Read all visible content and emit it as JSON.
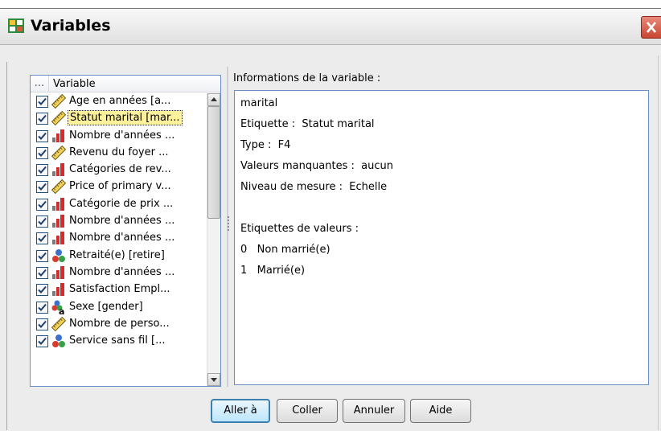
{
  "window": {
    "title": "Variables"
  },
  "list": {
    "header_col1": "...",
    "header_col2": "Variable",
    "items": [
      {
        "label": "Age en années [a...",
        "icon": "scale-ruler-icon",
        "checked": true
      },
      {
        "label": "Statut marital [mar...",
        "icon": "scale-ruler-icon",
        "checked": true,
        "selected": true
      },
      {
        "label": "Nombre d'années ...",
        "icon": "ordinal-bar-icon",
        "checked": true
      },
      {
        "label": "Revenu du foyer ...",
        "icon": "scale-ruler-icon",
        "checked": true
      },
      {
        "label": "Catégories de rev...",
        "icon": "ordinal-bar-icon",
        "checked": true
      },
      {
        "label": "Price of primary v...",
        "icon": "scale-ruler-icon",
        "checked": true
      },
      {
        "label": "Catégorie de prix ...",
        "icon": "ordinal-bar-icon",
        "checked": true
      },
      {
        "label": "Nombre d'années ...",
        "icon": "ordinal-bar-icon",
        "checked": true
      },
      {
        "label": "Nombre d'années ...",
        "icon": "ordinal-bar-icon",
        "checked": true
      },
      {
        "label": "Retraité(e) [retire]",
        "icon": "nominal-circles-icon",
        "checked": true
      },
      {
        "label": "Nombre d'années ...",
        "icon": "ordinal-bar-icon",
        "checked": true
      },
      {
        "label": "Satisfaction Empl...",
        "icon": "ordinal-bar-icon",
        "checked": true
      },
      {
        "label": "Sexe [gender]",
        "icon": "nominal-string-icon",
        "checked": true
      },
      {
        "label": "Nombre de perso...",
        "icon": "scale-ruler-icon",
        "checked": true
      },
      {
        "label": "Service sans fil [...",
        "icon": "nominal-circles-icon",
        "checked": true
      }
    ]
  },
  "info": {
    "title": "Informations de la variable :",
    "lines": [
      "marital",
      "Etiquette :  Statut marital",
      "Type :  F4",
      "Valeurs manquantes :  aucun",
      "Niveau de mesure :  Echelle",
      "",
      "Etiquettes de valeurs :",
      "0   Non marrié(e)",
      "1   Marrié(e)"
    ]
  },
  "buttons": {
    "goto": "Aller à",
    "paste": "Coller",
    "cancel": "Annuler",
    "help": "Aide"
  }
}
